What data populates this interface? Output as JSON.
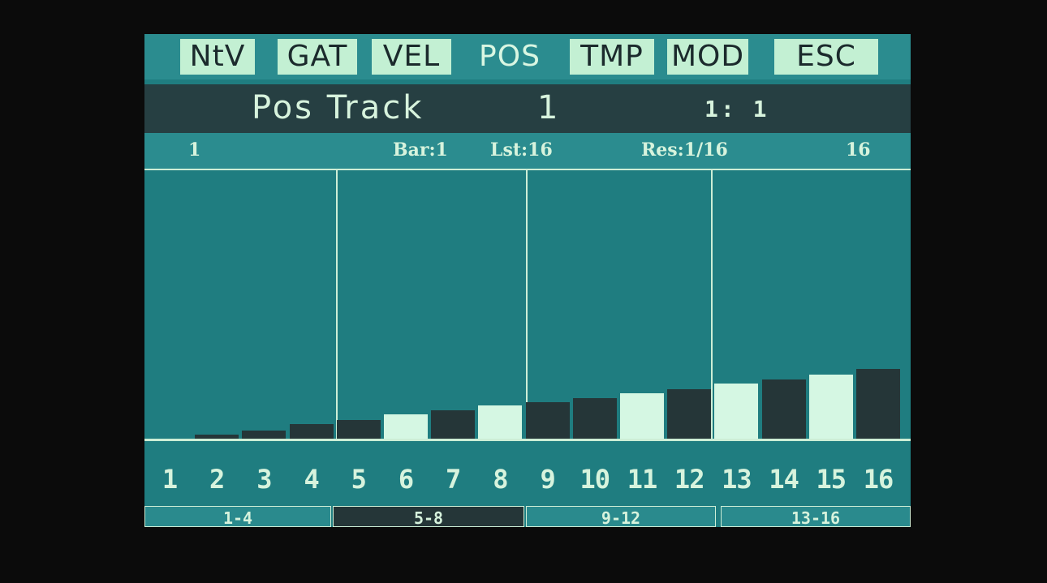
{
  "tabs": [
    {
      "label": "NtV",
      "active": true
    },
    {
      "label": "GAT",
      "active": true
    },
    {
      "label": "VEL",
      "active": true
    },
    {
      "label": "POS",
      "active": false
    },
    {
      "label": "TMP",
      "active": true
    },
    {
      "label": "MOD",
      "active": true
    },
    {
      "label": "ESC",
      "active": true
    }
  ],
  "title": {
    "track_label": "Pos Track",
    "track_number": "1",
    "position": "1: 1"
  },
  "info": {
    "start": "1",
    "bar": "Bar:1",
    "last": "Lst:16",
    "resolution": "Res:1/16",
    "end": "16"
  },
  "steps": [
    "1",
    "2",
    "3",
    "4",
    "5",
    "6",
    "7",
    "8",
    "9",
    "10",
    "11",
    "12",
    "13",
    "14",
    "15",
    "16"
  ],
  "chart_data": {
    "type": "bar",
    "categories": [
      "1",
      "2",
      "3",
      "4",
      "5",
      "6",
      "7",
      "8",
      "9",
      "10",
      "11",
      "12",
      "13",
      "14",
      "15",
      "16"
    ],
    "values": [
      0,
      1.5,
      3,
      5.5,
      7,
      9,
      10.5,
      12.5,
      13.5,
      15,
      17,
      18.5,
      20.5,
      22,
      24,
      26
    ],
    "ylim": [
      0,
      100
    ],
    "highlighted": [
      "6",
      "8",
      "11",
      "13",
      "15"
    ]
  },
  "pages": [
    "1-4",
    "5-8",
    "9-12",
    "13-16"
  ],
  "selected_page": "5-8"
}
